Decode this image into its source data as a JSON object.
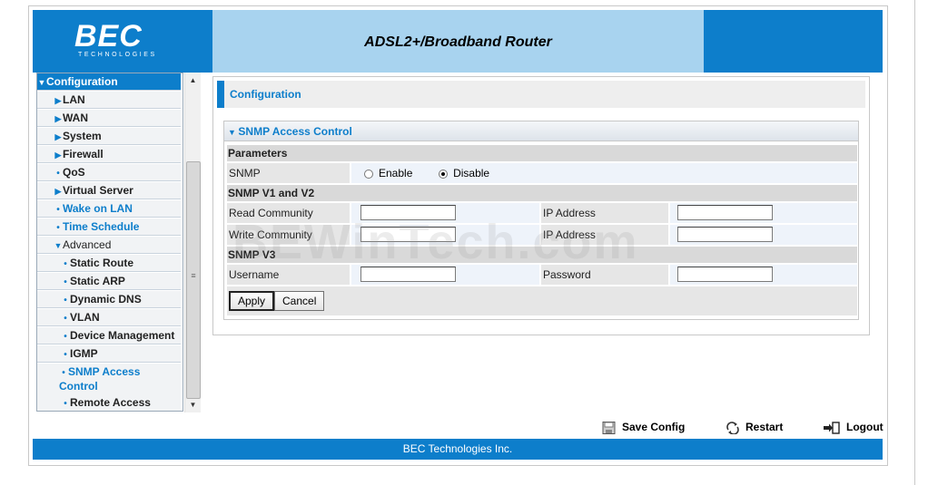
{
  "header": {
    "logo": "BEC",
    "logo_sub": "TECHNOLOGIES",
    "title": "ADSL2+/Broadband Router"
  },
  "sidebar": {
    "items": [
      {
        "label": "Configuration"
      },
      {
        "label": "LAN"
      },
      {
        "label": "WAN"
      },
      {
        "label": "System"
      },
      {
        "label": "Firewall"
      },
      {
        "label": "QoS"
      },
      {
        "label": "Virtual Server"
      },
      {
        "label": "Wake on LAN"
      },
      {
        "label": "Time Schedule"
      },
      {
        "label": "Advanced"
      },
      {
        "label": "Static Route"
      },
      {
        "label": "Static ARP"
      },
      {
        "label": "Dynamic DNS"
      },
      {
        "label": "VLAN"
      },
      {
        "label": "Device Management"
      },
      {
        "label": "IGMP"
      },
      {
        "label": "SNMP Access Control"
      },
      {
        "label": "Remote Access"
      }
    ]
  },
  "content": {
    "page_title": "Configuration",
    "panel_title": "SNMP Access Control",
    "parameters_label": "Parameters",
    "snmp_label": "SNMP",
    "enable_label": "Enable",
    "disable_label": "Disable",
    "snmp_selected": "Disable",
    "v1v2_label": "SNMP V1 and V2",
    "read_community_label": "Read Community",
    "write_community_label": "Write Community",
    "ip_address_label": "IP Address",
    "v3_label": "SNMP V3",
    "username_label": "Username",
    "password_label": "Password",
    "read_community_value": "",
    "write_community_value": "",
    "read_ip_value": "",
    "write_ip_value": "",
    "username_value": "",
    "password_value": "",
    "apply_label": "Apply",
    "cancel_label": "Cancel"
  },
  "watermark": "BEWinTech.com",
  "actions": {
    "save_config": "Save Config",
    "restart": "Restart",
    "logout": "Logout"
  },
  "footer": {
    "text": "BEC Technologies Inc."
  },
  "colors": {
    "brand_blue": "#0d7ecb",
    "title_bar": "#a8d3ef"
  }
}
